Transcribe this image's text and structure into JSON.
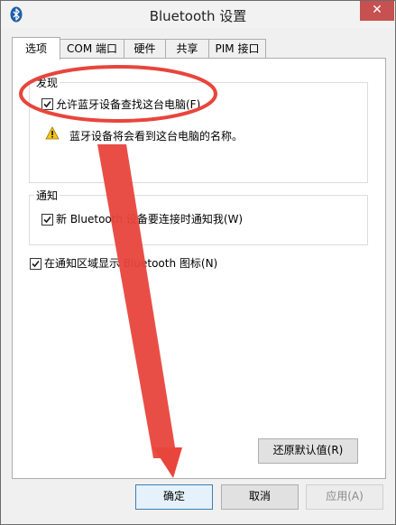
{
  "window": {
    "title": "Bluetooth 设置"
  },
  "title_bar": {
    "close_glyph": "✕",
    "app_icon": "bluetooth-icon"
  },
  "tabs": [
    {
      "label": "选项",
      "selected": true
    },
    {
      "label": "COM 端口",
      "selected": false
    },
    {
      "label": "硬件",
      "selected": false
    },
    {
      "label": "共享",
      "selected": false
    },
    {
      "label": "PIM 接口",
      "selected": false
    }
  ],
  "discovery": {
    "group_label": "发现",
    "allow_discovery": {
      "label": "允许蓝牙设备查找这台电脑(F)",
      "checked": true
    },
    "warning_text": "蓝牙设备将会看到这台电脑的名称。",
    "warning_icon": "warning-icon"
  },
  "notifications": {
    "group_label": "通知",
    "notify_on_connect": {
      "label": "新 Bluetooth 设备要连接时通知我(W)",
      "checked": true
    }
  },
  "show_tray_icon": {
    "label": "在通知区域显示 Bluetooth 图标(N)",
    "checked": true
  },
  "buttons": {
    "restore_defaults": "还原默认值(R)",
    "ok": "确定",
    "cancel": "取消",
    "apply": "应用(A)",
    "apply_enabled": false
  },
  "annotation": {
    "color": "#e8453c"
  }
}
